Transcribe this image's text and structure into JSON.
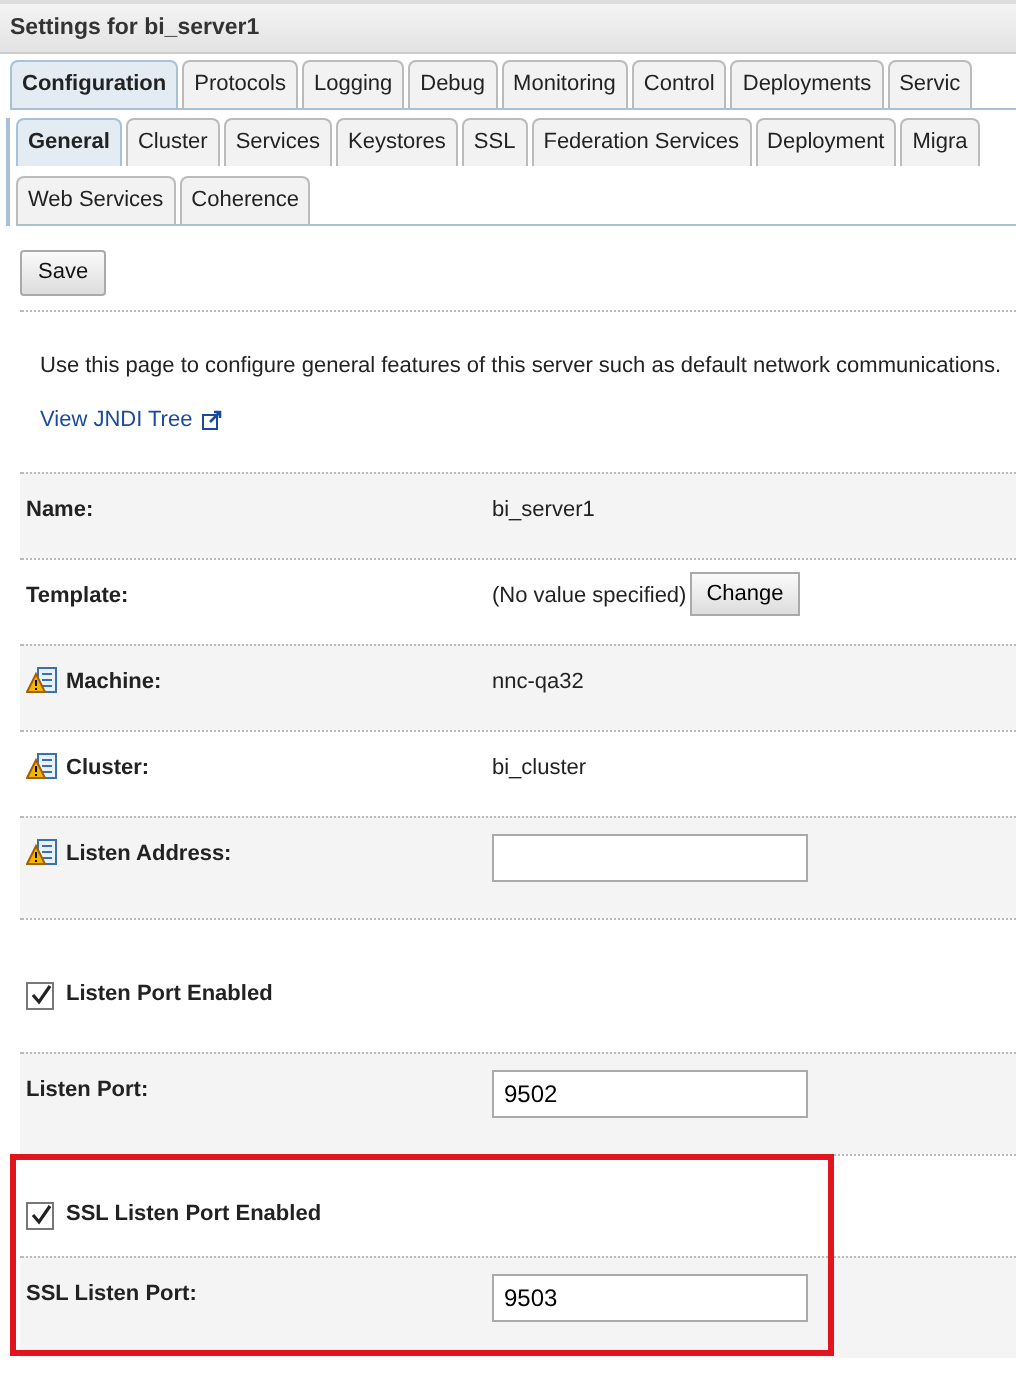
{
  "title": "Settings for bi_server1",
  "tabs": [
    {
      "label": "Configuration",
      "selected": true
    },
    {
      "label": "Protocols",
      "selected": false
    },
    {
      "label": "Logging",
      "selected": false
    },
    {
      "label": "Debug",
      "selected": false
    },
    {
      "label": "Monitoring",
      "selected": false
    },
    {
      "label": "Control",
      "selected": false
    },
    {
      "label": "Deployments",
      "selected": false
    },
    {
      "label": "Servic",
      "selected": false
    }
  ],
  "subtabs": [
    [
      {
        "label": "General",
        "selected": true
      },
      {
        "label": "Cluster",
        "selected": false
      },
      {
        "label": "Services",
        "selected": false
      },
      {
        "label": "Keystores",
        "selected": false
      },
      {
        "label": "SSL",
        "selected": false
      },
      {
        "label": "Federation Services",
        "selected": false
      },
      {
        "label": "Deployment",
        "selected": false
      },
      {
        "label": "Migra",
        "selected": false
      }
    ],
    [
      {
        "label": "Web Services",
        "selected": false
      },
      {
        "label": "Coherence",
        "selected": false
      }
    ]
  ],
  "save_button": "Save",
  "description": "Use this page to configure general features of this server such as default network communications.",
  "link": "View JNDI Tree",
  "rows": [
    {
      "kind": "text",
      "label": "Name:",
      "value": "bi_server1",
      "warning": false,
      "highlighted": false
    },
    {
      "kind": "button",
      "label": "Template:",
      "value": "(No value specified)",
      "button": "Change",
      "warning": false,
      "highlighted": false
    },
    {
      "kind": "text",
      "label": "Machine:",
      "value": "nnc-qa32",
      "warning": true,
      "highlighted": false
    },
    {
      "kind": "text",
      "label": "Cluster:",
      "value": "bi_cluster",
      "warning": true,
      "highlighted": false
    },
    {
      "kind": "input",
      "label": "Listen Address:",
      "warning": true,
      "highlighted": false
    },
    {
      "kind": "checkbox",
      "label": "Listen Port Enabled",
      "checked": true,
      "warning": false,
      "highlighted": false
    },
    {
      "kind": "input",
      "label": "Listen Port:",
      "value": "9502",
      "warning": false,
      "highlighted": false
    },
    {
      "kind": "checkbox",
      "label": "SSL Listen Port Enabled",
      "checked": true,
      "warning": false,
      "highlighted": true
    },
    {
      "kind": "input",
      "label": "SSL Listen Port:",
      "value": "9503",
      "warning": false,
      "highlighted": true
    }
  ]
}
